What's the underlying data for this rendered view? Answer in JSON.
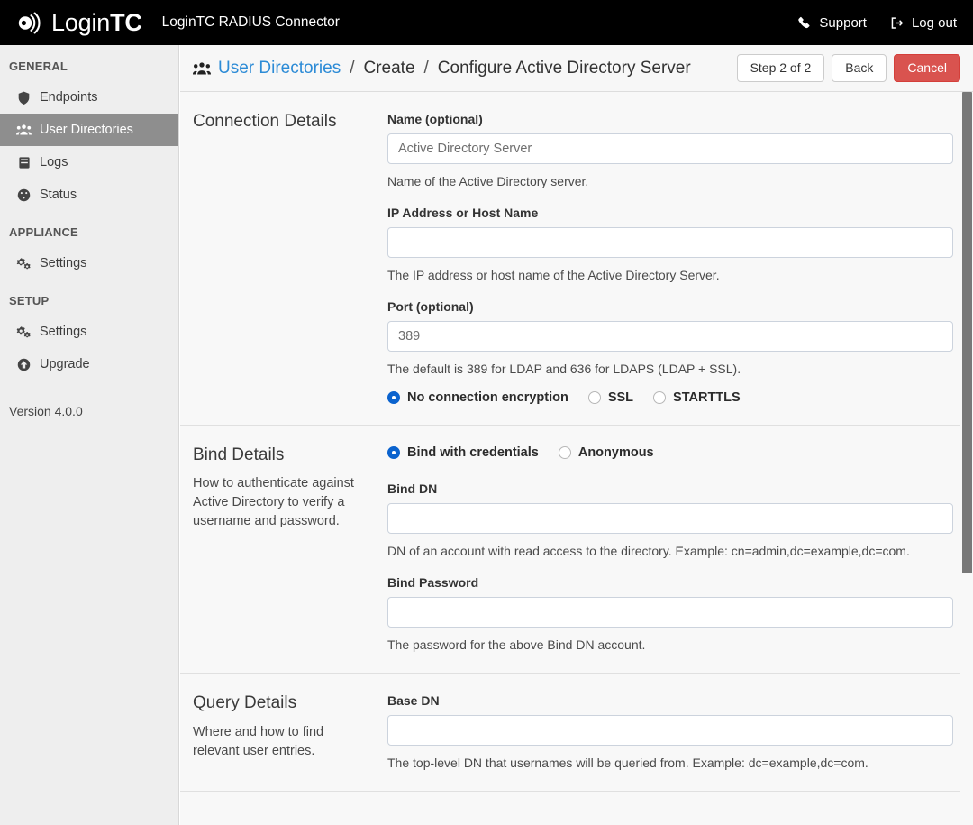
{
  "topbar": {
    "brand_text_light": "Login",
    "brand_text_bold": "TC",
    "app_title": "LoginTC RADIUS Connector",
    "support_label": "Support",
    "logout_label": "Log out"
  },
  "sidebar": {
    "groups": [
      {
        "title": "GENERAL",
        "items": [
          {
            "label": "Endpoints",
            "icon": "shield-icon",
            "active": false
          },
          {
            "label": "User Directories",
            "icon": "users-icon",
            "active": true
          },
          {
            "label": "Logs",
            "icon": "book-icon",
            "active": false
          },
          {
            "label": "Status",
            "icon": "dashboard-icon",
            "active": false
          }
        ]
      },
      {
        "title": "APPLIANCE",
        "items": [
          {
            "label": "Settings",
            "icon": "cogs-icon",
            "active": false
          }
        ]
      },
      {
        "title": "SETUP",
        "items": [
          {
            "label": "Settings",
            "icon": "cogs-icon",
            "active": false
          },
          {
            "label": "Upgrade",
            "icon": "arrow-circle-up-icon",
            "active": false
          }
        ]
      }
    ],
    "version": "Version 4.0.0"
  },
  "page_head": {
    "breadcrumb_link": "User Directories",
    "breadcrumb_sep1": "/",
    "breadcrumb_middle": "Create",
    "breadcrumb_sep2": "/",
    "breadcrumb_current": "Configure Active Directory Server",
    "step_label": "Step 2 of 2",
    "back_label": "Back",
    "cancel_label": "Cancel"
  },
  "sections": {
    "connection": {
      "title": "Connection Details",
      "name": {
        "label": "Name (optional)",
        "value": "",
        "placeholder": "Active Directory Server",
        "help": "Name of the Active Directory server."
      },
      "host": {
        "label": "IP Address or Host Name",
        "value": "",
        "placeholder": "",
        "help": "The IP address or host name of the Active Directory Server."
      },
      "port": {
        "label": "Port (optional)",
        "value": "",
        "placeholder": "389",
        "help": "The default is 389 for LDAP and 636 for LDAPS (LDAP + SSL)."
      },
      "encryption_options": [
        {
          "label": "No connection encryption",
          "checked": true
        },
        {
          "label": "SSL",
          "checked": false
        },
        {
          "label": "STARTTLS",
          "checked": false
        }
      ]
    },
    "bind": {
      "title": "Bind Details",
      "description": "How to authenticate against Active Directory to verify a username and password.",
      "mode_options": [
        {
          "label": "Bind with credentials",
          "checked": true
        },
        {
          "label": "Anonymous",
          "checked": false
        }
      ],
      "bind_dn": {
        "label": "Bind DN",
        "value": "",
        "placeholder": "",
        "help": "DN of an account with read access to the directory. Example: cn=admin,dc=example,dc=com."
      },
      "bind_password": {
        "label": "Bind Password",
        "value": "",
        "placeholder": "",
        "help": "The password for the above Bind DN account."
      }
    },
    "query": {
      "title": "Query Details",
      "description": "Where and how to find relevant user entries.",
      "base_dn": {
        "label": "Base DN",
        "value": "",
        "placeholder": "",
        "help": "The top-level DN that usernames will be queried from. Example: dc=example,dc=com."
      }
    }
  },
  "colors": {
    "accent_link": "#2c8bd6",
    "danger": "#d9534f",
    "radio_selected": "#0b63ce",
    "sidebar_active": "#8e8e8e",
    "topbar_bg": "#000000"
  }
}
